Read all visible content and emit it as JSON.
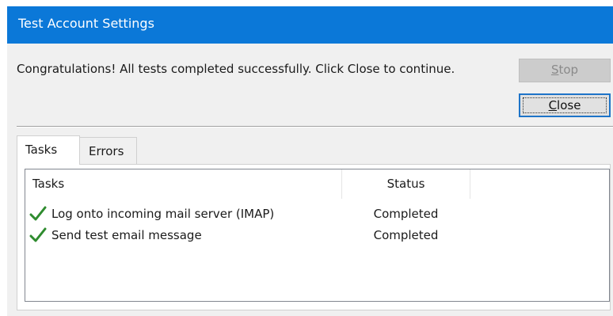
{
  "window": {
    "title": "Test Account Settings"
  },
  "message": "Congratulations! All tests completed successfully. Click Close to continue.",
  "buttons": {
    "stop": {
      "pre": "",
      "key": "S",
      "post": "top",
      "enabled": false
    },
    "close": {
      "pre": "",
      "key": "C",
      "post": "lose",
      "enabled": true
    }
  },
  "tabs": [
    {
      "label": "Tasks",
      "selected": true
    },
    {
      "label": "Errors",
      "selected": false
    }
  ],
  "table": {
    "columns": [
      "Tasks",
      "Status"
    ],
    "rows": [
      {
        "icon": "checkmark-icon",
        "task": "Log onto incoming mail server (IMAP)",
        "status": "Completed"
      },
      {
        "icon": "checkmark-icon",
        "task": "Send test email message",
        "status": "Completed"
      }
    ]
  },
  "colors": {
    "title_bar": "#0b78d8",
    "dialog_bg": "#f0f0f0",
    "check_green": "#2e8b2e",
    "focus_border": "#1e74c8"
  }
}
